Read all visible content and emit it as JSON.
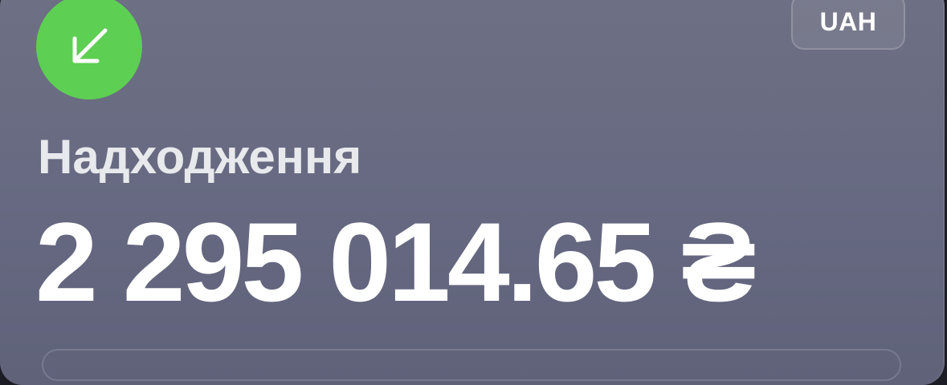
{
  "transaction": {
    "icon": "arrow-down-left-icon",
    "icon_color": "#5dcf52",
    "currency": "UAH",
    "label": "Надходження",
    "amount": "2 295 014.65 ₴"
  }
}
